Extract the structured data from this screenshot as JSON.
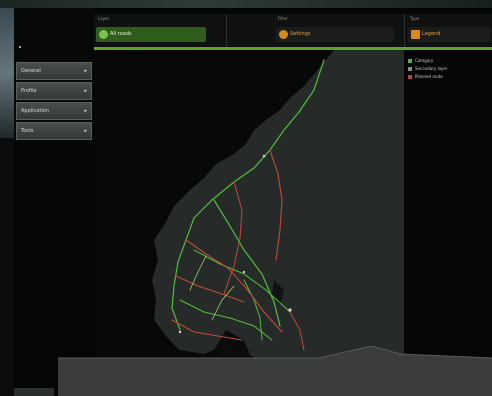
{
  "sidebar": {
    "items": [
      {
        "label": "General",
        "arrow": "▸"
      },
      {
        "label": "Profile",
        "arrow": "▸"
      },
      {
        "label": "Application",
        "arrow": "▸"
      },
      {
        "label": "Tools",
        "arrow": "▸"
      }
    ]
  },
  "toolbar": {
    "groups": [
      {
        "caption": "Layer",
        "label": "All roads",
        "color": "#3f7d22"
      },
      {
        "caption": "Filter",
        "label": "Settings",
        "color": "#c77b0f"
      },
      {
        "caption": "Type",
        "label": "Legend",
        "color": "#c77b0f"
      }
    ]
  },
  "legend": {
    "items": [
      {
        "label": "Category",
        "color": "#6aa84f"
      },
      {
        "label": "Secondary layer",
        "color": "#8a8f8c"
      },
      {
        "label": "Planned route",
        "color": "#b04a3a"
      }
    ]
  },
  "colors": {
    "accent_green": "#5fa428",
    "accent_orange": "#c77b0f",
    "road_green": "#4fbf3a",
    "road_red": "#c24a3a"
  }
}
